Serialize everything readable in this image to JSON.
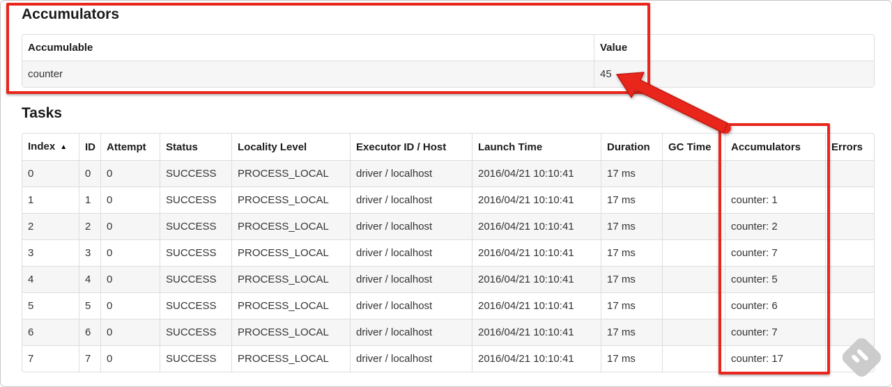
{
  "accumulators_section": {
    "heading": "Accumulators",
    "table": {
      "headers": [
        {
          "label": "Accumulable"
        },
        {
          "label": "Value"
        }
      ],
      "rows": [
        [
          "counter",
          "45"
        ]
      ]
    }
  },
  "tasks_section": {
    "heading": "Tasks",
    "table": {
      "sort_asc_icon": "▲",
      "headers": [
        {
          "label": "Index",
          "sorted": "asc"
        },
        {
          "label": "ID"
        },
        {
          "label": "Attempt"
        },
        {
          "label": "Status"
        },
        {
          "label": "Locality Level"
        },
        {
          "label": "Executor ID / Host"
        },
        {
          "label": "Launch Time"
        },
        {
          "label": "Duration"
        },
        {
          "label": "GC Time"
        },
        {
          "label": "Accumulators"
        },
        {
          "label": "Errors"
        }
      ],
      "rows": [
        [
          "0",
          "0",
          "0",
          "SUCCESS",
          "PROCESS_LOCAL",
          "driver / localhost",
          "2016/04/21 10:10:41",
          "17 ms",
          "",
          "",
          ""
        ],
        [
          "1",
          "1",
          "0",
          "SUCCESS",
          "PROCESS_LOCAL",
          "driver / localhost",
          "2016/04/21 10:10:41",
          "17 ms",
          "",
          "counter: 1",
          ""
        ],
        [
          "2",
          "2",
          "0",
          "SUCCESS",
          "PROCESS_LOCAL",
          "driver / localhost",
          "2016/04/21 10:10:41",
          "17 ms",
          "",
          "counter: 2",
          ""
        ],
        [
          "3",
          "3",
          "0",
          "SUCCESS",
          "PROCESS_LOCAL",
          "driver / localhost",
          "2016/04/21 10:10:41",
          "17 ms",
          "",
          "counter: 7",
          ""
        ],
        [
          "4",
          "4",
          "0",
          "SUCCESS",
          "PROCESS_LOCAL",
          "driver / localhost",
          "2016/04/21 10:10:41",
          "17 ms",
          "",
          "counter: 5",
          ""
        ],
        [
          "5",
          "5",
          "0",
          "SUCCESS",
          "PROCESS_LOCAL",
          "driver / localhost",
          "2016/04/21 10:10:41",
          "17 ms",
          "",
          "counter: 6",
          ""
        ],
        [
          "6",
          "6",
          "0",
          "SUCCESS",
          "PROCESS_LOCAL",
          "driver / localhost",
          "2016/04/21 10:10:41",
          "17 ms",
          "",
          "counter: 7",
          ""
        ],
        [
          "7",
          "7",
          "0",
          "SUCCESS",
          "PROCESS_LOCAL",
          "driver / localhost",
          "2016/04/21 10:10:41",
          "17 ms",
          "",
          "counter: 17",
          ""
        ]
      ]
    }
  },
  "annotations": {
    "highlight_color": "#e8261b"
  },
  "watermark_icon": "feedly-icon"
}
